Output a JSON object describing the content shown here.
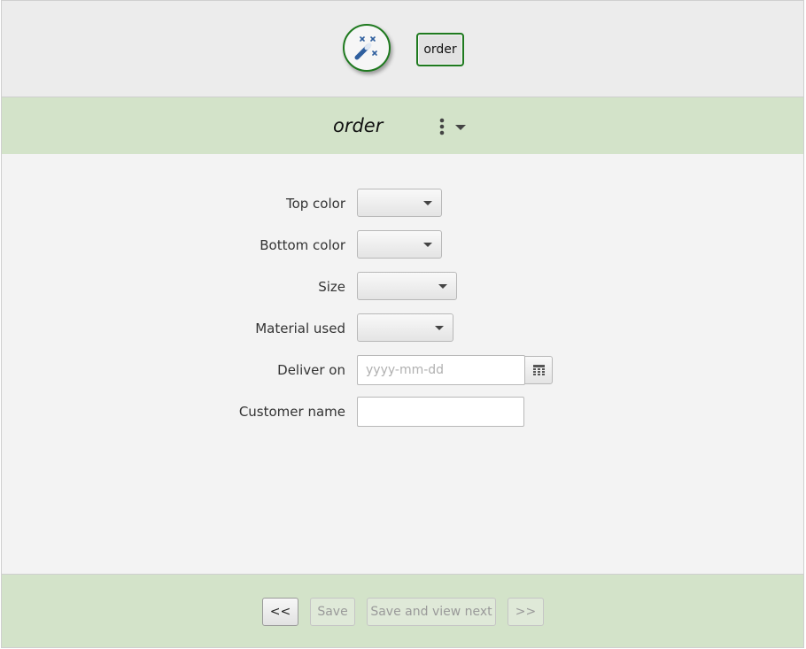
{
  "header": {
    "wand_icon": "magic-wand-icon",
    "tab_label": "order"
  },
  "form": {
    "title": "order",
    "menu_icon": "kebab-dropdown-icon",
    "fields": {
      "top_color": {
        "label": "Top color",
        "value": ""
      },
      "bottom_color": {
        "label": "Bottom color",
        "value": ""
      },
      "size": {
        "label": "Size",
        "value": ""
      },
      "material_used": {
        "label": "Material used",
        "value": ""
      },
      "deliver_on": {
        "label": "Deliver on",
        "placeholder": "yyyy-mm-dd",
        "value": "",
        "icon": "calendar-icon"
      },
      "customer_name": {
        "label": "Customer name",
        "value": ""
      }
    }
  },
  "footer": {
    "prev_label": "<<",
    "save_label": "Save",
    "save_next_label": "Save and view next",
    "next_label": ">>"
  }
}
